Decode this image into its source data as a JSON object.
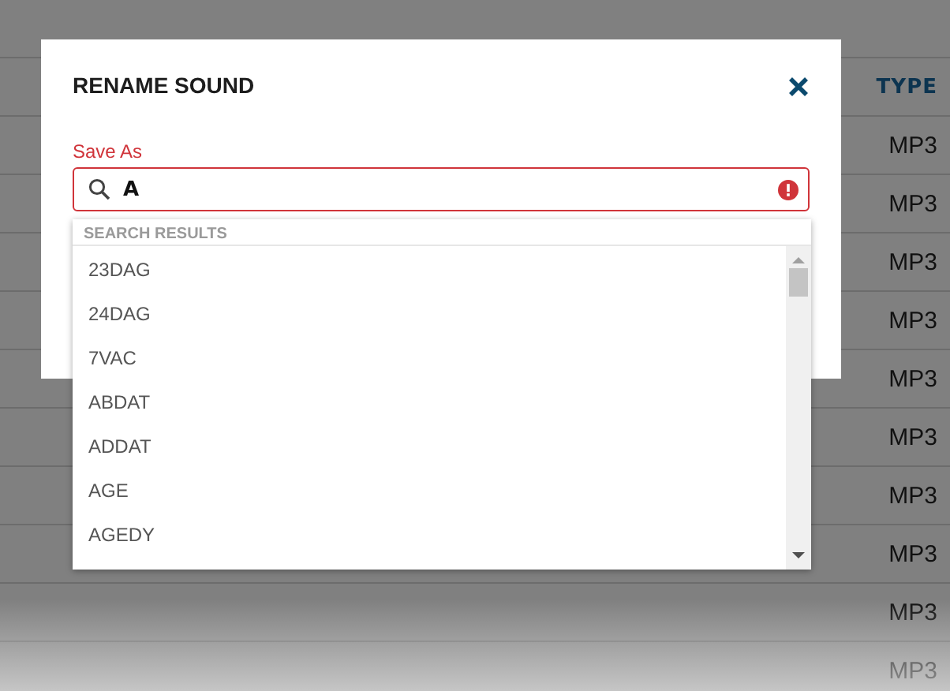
{
  "table": {
    "columns": [
      {
        "label": "TYPE"
      }
    ],
    "rows": [
      {
        "type": "MP3"
      },
      {
        "type": "MP3"
      },
      {
        "type": "MP3"
      },
      {
        "type": "MP3"
      },
      {
        "type": "MP3"
      },
      {
        "type": "MP3"
      },
      {
        "type": "MP3"
      },
      {
        "type": "MP3"
      },
      {
        "type": "MP3"
      },
      {
        "type": "MP3"
      }
    ]
  },
  "dialog": {
    "title": "RENAME SOUND",
    "field": {
      "label": "Save As",
      "value": "A",
      "invalid": true
    },
    "results": {
      "heading": "SEARCH RESULTS",
      "items": [
        "23DAG",
        "24DAG",
        "7VAC",
        "ABDAT",
        "ADDAT",
        "AGE",
        "AGEDY"
      ]
    }
  }
}
